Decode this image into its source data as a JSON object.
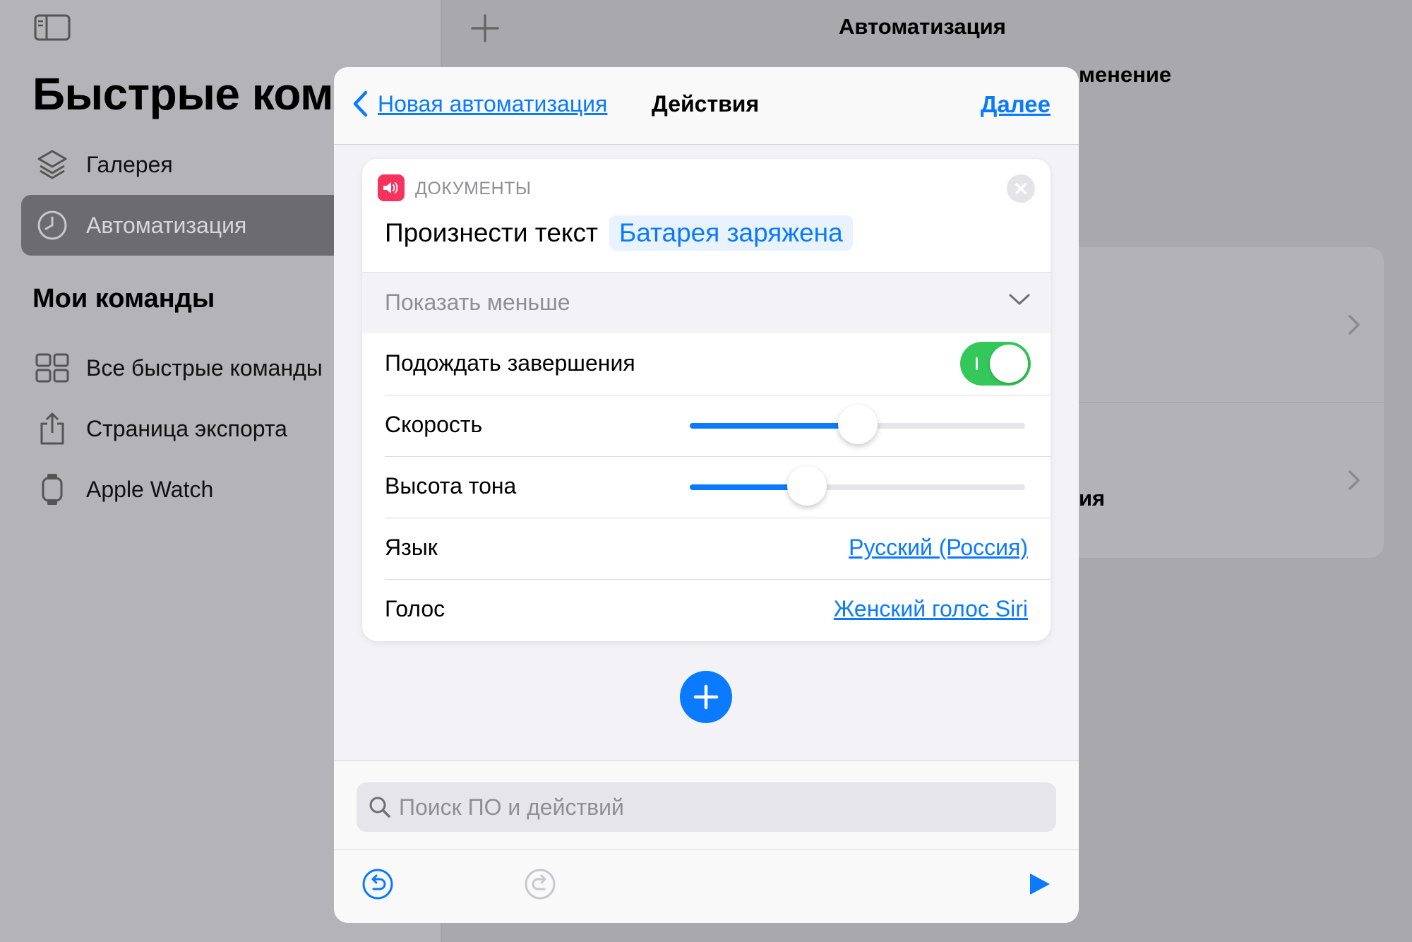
{
  "sidebar": {
    "title": "Быстрые команды",
    "items": [
      {
        "label": "Галерея",
        "icon": "layers-icon"
      },
      {
        "label": "Автоматизация",
        "icon": "clock-icon",
        "active": true
      }
    ],
    "section_title": "Мои команды",
    "my_items": [
      {
        "label": "Все быстрые команды",
        "icon": "grid-icon"
      },
      {
        "label": "Страница экспорта",
        "icon": "share-icon"
      },
      {
        "label": "Apple Watch",
        "icon": "watch-icon"
      }
    ]
  },
  "main": {
    "title": "Автоматизация",
    "subtitle_fragment": "менение",
    "card_text_fragment": "ия"
  },
  "sheet": {
    "back_label": "Новая автоматизация",
    "title": "Действия",
    "next_label": "Далее",
    "action": {
      "category": "ДОКУМЕНТЫ",
      "verb": "Произнести текст",
      "token": "Батарея заряжена",
      "show_less": "Показать меньше",
      "wait_label": "Подождать завершения",
      "wait_enabled": true,
      "rate_label": "Скорость",
      "rate_value": 0.5,
      "pitch_label": "Высота тона",
      "pitch_value": 0.35,
      "language_label": "Язык",
      "language_value": "Русский (Россия)",
      "voice_label": "Голос",
      "voice_value": "Женский голос Siri"
    },
    "search_placeholder": "Поиск ПО и действий"
  },
  "colors": {
    "accent": "#0a7aff",
    "toggle_on": "#34c759",
    "app_badge": "#f5335e"
  }
}
